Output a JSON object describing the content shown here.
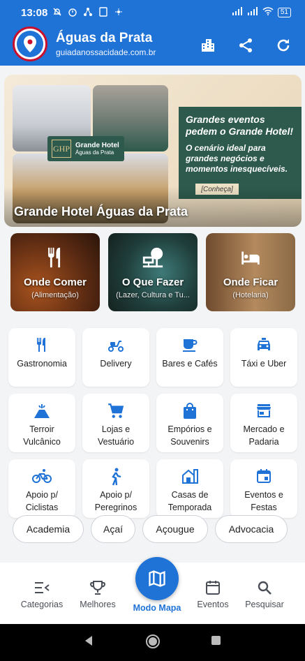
{
  "status": {
    "time": "13:08",
    "battery": "51"
  },
  "app": {
    "title": "Águas da Prata",
    "subtitle": "guiadanossacidade.com.br"
  },
  "banner": {
    "badge_line1": "Grande Hotel",
    "badge_line2": "Águas da Prata",
    "monogram": "GHP",
    "headline": "Grandes eventos pedem o Grande Hotel!",
    "body": "O cenário ideal para grandes negócios e momentos inesquecíveis.",
    "cta": "[Conheça]",
    "title": "Grande Hotel Águas da Prata"
  },
  "featured": [
    {
      "title": "Onde Comer",
      "subtitle": "(Alimentação)",
      "icon": "fork-knife-icon"
    },
    {
      "title": "O Que Fazer",
      "subtitle": "(Lazer, Cultura e Tu...",
      "icon": "tree-sign-icon"
    },
    {
      "title": "Onde Ficar",
      "subtitle": "(Hotelaria)",
      "icon": "bed-icon"
    }
  ],
  "categories": [
    {
      "label": "Gastronomia",
      "icon": "fork-knife-icon"
    },
    {
      "label": "Delivery",
      "icon": "scooter-icon"
    },
    {
      "label": "Bares e Cafés",
      "icon": "coffee-cup-icon"
    },
    {
      "label": "Táxi e  Uber",
      "icon": "taxi-icon"
    },
    {
      "label": "Terroir Vulcânico",
      "icon": "volcano-icon"
    },
    {
      "label": "Lojas e Vestuário",
      "icon": "shopping-cart-icon"
    },
    {
      "label": "Empórios e Souvenirs",
      "icon": "shopping-bag-icon"
    },
    {
      "label": "Mercado  e Padaria",
      "icon": "storefront-icon"
    },
    {
      "label": "Apoio p/ Ciclistas",
      "icon": "bicycle-icon"
    },
    {
      "label": "Apoio p/ Peregrinos",
      "icon": "walking-icon"
    },
    {
      "label": "Casas de Temporada",
      "icon": "house-icon"
    },
    {
      "label": "Eventos e Festas",
      "icon": "calendar-icon"
    }
  ],
  "chips": [
    "Academia",
    "Açaí",
    "Açougue",
    "Advocacia"
  ],
  "nav": {
    "categorias": "Categorias",
    "melhores": "Melhores",
    "modo_mapa": "Modo Mapa",
    "eventos": "Eventos",
    "pesquisar": "Pesquisar"
  },
  "colors": {
    "primary": "#1f72d6",
    "promo_green": "#2d5a4c",
    "logo_red": "#c8102e"
  }
}
